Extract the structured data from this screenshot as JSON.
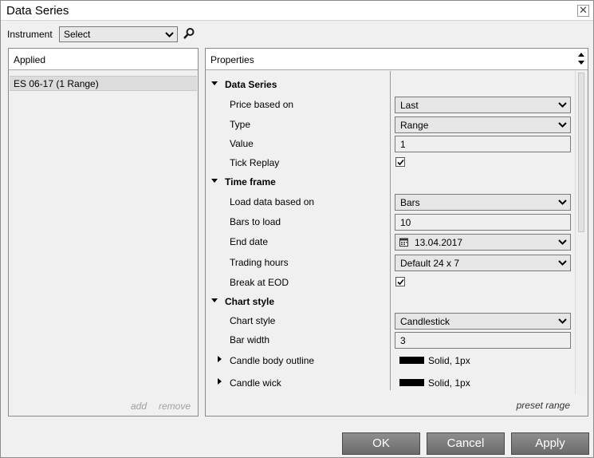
{
  "window": {
    "title": "Data Series"
  },
  "instrument": {
    "label": "Instrument",
    "value": "Select"
  },
  "applied": {
    "header": "Applied",
    "items": [
      "ES 06-17 (1 Range)"
    ],
    "add_label": "add",
    "remove_label": "remove"
  },
  "properties": {
    "header": "Properties",
    "categories": {
      "data_series": "Data Series",
      "time_frame": "Time frame",
      "chart_style": "Chart style"
    },
    "rows": {
      "price_based_on": {
        "label": "Price based on",
        "value": "Last"
      },
      "type": {
        "label": "Type",
        "value": "Range"
      },
      "value": {
        "label": "Value",
        "value": "1"
      },
      "tick_replay": {
        "label": "Tick Replay",
        "checked": true
      },
      "load_data": {
        "label": "Load data based on",
        "value": "Bars"
      },
      "bars_to_load": {
        "label": "Bars to load",
        "value": "10"
      },
      "end_date": {
        "label": "End date",
        "value": "13.04.2017"
      },
      "trading_hours": {
        "label": "Trading hours",
        "value": "Default 24 x 7"
      },
      "break_eod": {
        "label": "Break at EOD",
        "checked": true
      },
      "chart_style": {
        "label": "Chart style",
        "value": "Candlestick"
      },
      "bar_width": {
        "label": "Bar width",
        "value": "3"
      },
      "candle_body_outline": {
        "label": "Candle body outline",
        "value": "Solid, 1px"
      },
      "candle_wick": {
        "label": "Candle wick",
        "value": "Solid, 1px"
      }
    },
    "preset_label": "preset range"
  },
  "buttons": {
    "ok": "OK",
    "cancel": "Cancel",
    "apply": "Apply"
  },
  "colors": {
    "button_bg": "#7d7d7d",
    "stroke_swatch": "#000000",
    "selected_row": "#dcdcdc"
  },
  "icons": {
    "close": "close-icon",
    "search": "search-icon",
    "calendar": "calendar-icon"
  }
}
